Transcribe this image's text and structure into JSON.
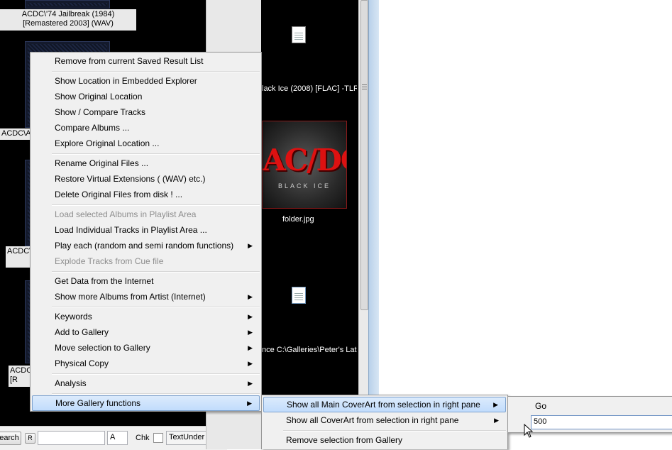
{
  "left_pane": {
    "albums": [
      {
        "caption": "ACDC\\'74 Jailbreak (1984) [Remastered 2003] (WAV)"
      },
      {
        "caption": "ACDC\\A"
      },
      {
        "caption": "ACDC\\"
      },
      {
        "caption": "ACDC"
      },
      {
        "caption": "[R"
      }
    ]
  },
  "bottom_bar": {
    "search_label": "earch",
    "r_label": "R",
    "search_value": "",
    "a_value": "A",
    "chk_label": "Chk",
    "textunder_value": "TextUnder"
  },
  "middle_pane": {
    "file1_label": "lack Ice (2008) [FLAC] -TLR",
    "cover_label": "folder.jpg",
    "cover_logo": "AC/DC",
    "cover_subtitle": "BLACK ICE",
    "file3_label": "nce C:\\Galleries\\Peter's Late"
  },
  "context_menu": {
    "items": [
      {
        "label": "Remove from current Saved Result List"
      },
      {
        "label": "Show Location in Embedded Explorer"
      },
      {
        "label": "Show Original Location"
      },
      {
        "label": "Show / Compare Tracks"
      },
      {
        "label": "Compare Albums ..."
      },
      {
        "label": "Explore Original Location ..."
      },
      {
        "label": "Rename Original Files ..."
      },
      {
        "label": "Restore Virtual Extensions ( (WAV) etc.)"
      },
      {
        "label": "Delete Original Files from disk ! ..."
      },
      {
        "label": "Load selected Albums in Playlist Area"
      },
      {
        "label": "Load Individual Tracks in Playlist Area ..."
      },
      {
        "label": "Play each (random and semi random functions)"
      },
      {
        "label": "Explode Tracks from Cue file"
      },
      {
        "label": "Get Data from the Internet"
      },
      {
        "label": "Show more Albums from Artist (Internet)"
      },
      {
        "label": "Keywords"
      },
      {
        "label": "Add to Gallery"
      },
      {
        "label": "Move selection to Gallery"
      },
      {
        "label": "Physical Copy"
      },
      {
        "label": "Analysis"
      },
      {
        "label": "More Gallery functions"
      }
    ]
  },
  "gallery_submenu": {
    "items": [
      {
        "label": "Show all Main CoverArt from selection in right pane"
      },
      {
        "label": "Show all CoverArt from selection in right pane"
      },
      {
        "label": "Remove selection from Gallery"
      }
    ]
  },
  "coverart_submenu": {
    "go_label": "Go",
    "count_value": "500"
  },
  "colors": {
    "highlight": "#c1dcfc",
    "pane_background": "#000000",
    "disabled_text": "#8d8d8d"
  }
}
